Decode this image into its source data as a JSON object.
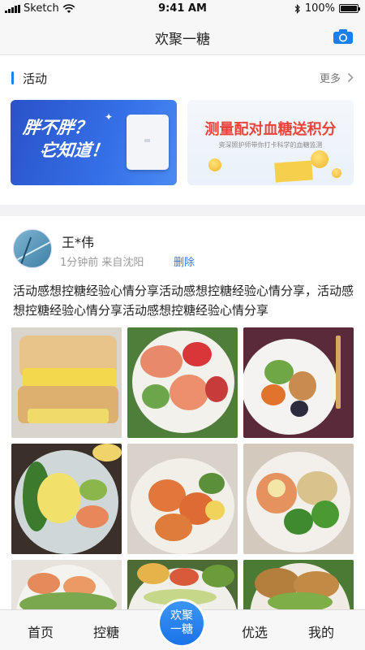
{
  "status_bar": {
    "carrier": "Sketch",
    "time": "9:41 AM",
    "battery": "100%"
  },
  "header": {
    "title": "欢聚一糖",
    "camera_icon": "camera-icon"
  },
  "activity": {
    "title": "活动",
    "more_label": "更多",
    "banners": [
      {
        "line1": "胖不胖？",
        "line2": "它知道！"
      },
      {
        "title": "测量配对血糖送积分",
        "subtitle": "资深照护师带你打卡科学的血糖监测"
      }
    ]
  },
  "post": {
    "user_name": "王*伟",
    "meta": "1分钟前  来自沈阳",
    "delete_label": "删除",
    "text": "活动感想控糖经验心情分享活动感想控糖经验心情分享，活动感想控糖经验心情分享活动感想控糖经验心情分享"
  },
  "tab_bar": {
    "home": "首页",
    "sugar_control": "控糖",
    "center_line1": "欢聚",
    "center_line2": "一糖",
    "featured": "优选",
    "mine": "我的"
  },
  "colors": {
    "accent": "#1a7ff0",
    "delete_link": "#2e7bd8",
    "banner_red": "#e8443a"
  }
}
